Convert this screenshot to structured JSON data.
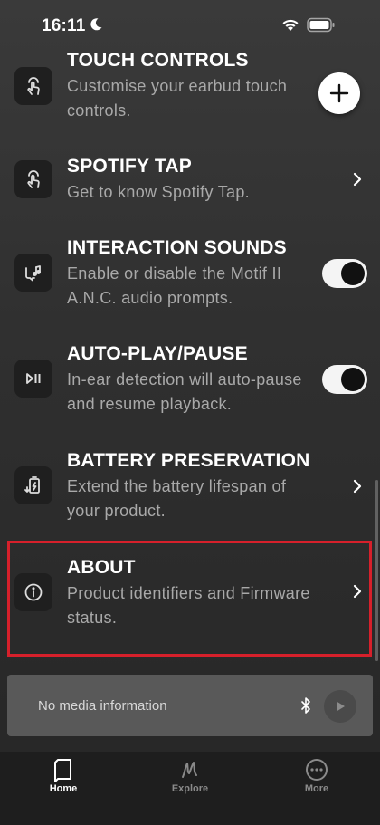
{
  "status_bar": {
    "time": "16:11",
    "icons": [
      "moon-icon",
      "wifi-icon",
      "battery-icon"
    ]
  },
  "settings": [
    {
      "title": "TOUCH CONTROLS",
      "description": "Customise your earbud touch controls.",
      "icon": "touch-gesture-icon",
      "control": "chevron"
    },
    {
      "title": "SPOTIFY TAP",
      "description": "Get to know Spotify Tap.",
      "icon": "touch-gesture-icon",
      "control": "chevron"
    },
    {
      "title": "INTERACTION SOUNDS",
      "description": "Enable or disable the Motif II A.N.C. audio prompts.",
      "icon": "sound-prompt-icon",
      "control": "toggle",
      "toggle_on": true
    },
    {
      "title": "AUTO-PLAY/PAUSE",
      "description": "In-ear detection will auto-pause and resume playback.",
      "icon": "play-pause-icon",
      "control": "toggle",
      "toggle_on": true
    },
    {
      "title": "BATTERY PRESERVATION",
      "description": "Extend the battery lifespan of your product.",
      "icon": "battery-charge-icon",
      "control": "chevron"
    },
    {
      "title": "ABOUT",
      "description": "Product identifiers and Firmware status.",
      "icon": "info-icon",
      "control": "chevron"
    }
  ],
  "fab": {
    "icon": "plus-icon"
  },
  "mini_player": {
    "text": "No media information",
    "icons": [
      "bluetooth-icon",
      "play-icon"
    ]
  },
  "tab_bar": {
    "tabs": [
      {
        "label": "Home",
        "icon": "home-icon",
        "active": true
      },
      {
        "label": "Explore",
        "icon": "marshall-logo-icon",
        "active": false
      },
      {
        "label": "More",
        "icon": "more-dots-icon",
        "active": false
      }
    ]
  },
  "colors": {
    "highlight": "#d6202b",
    "toggle_track": "#f4f4f4",
    "description_text": "#a9a9a9"
  }
}
